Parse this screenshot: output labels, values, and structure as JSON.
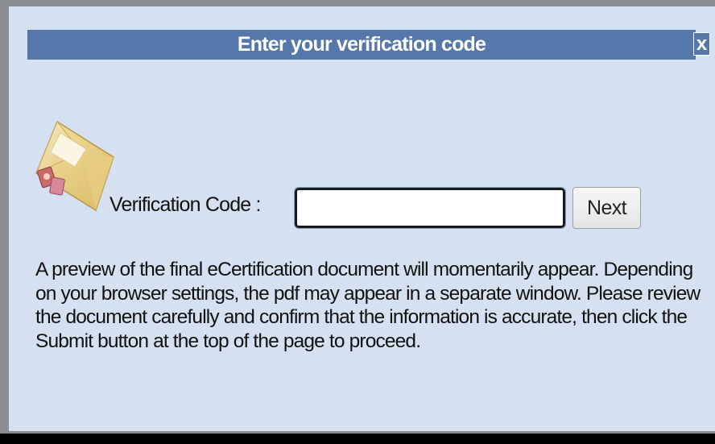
{
  "dialog": {
    "title": "Enter your verification code",
    "close_label": "x"
  },
  "icons": {
    "envelope": "envelope-with-stamps-icon"
  },
  "form": {
    "label": "Verification Code :",
    "input_value": "",
    "input_placeholder": "",
    "next_label": "Next"
  },
  "info": {
    "text": "A preview of the final eCertification document will momentarily appear. Depending on your browser settings, the pdf may appear in a separate window. Please review the document carefully and confirm that the information is accurate, then click the Submit button at the top of the page to proceed."
  },
  "colors": {
    "title_bar": "#5577aa",
    "dialog_bg": "#d5e0f0"
  }
}
